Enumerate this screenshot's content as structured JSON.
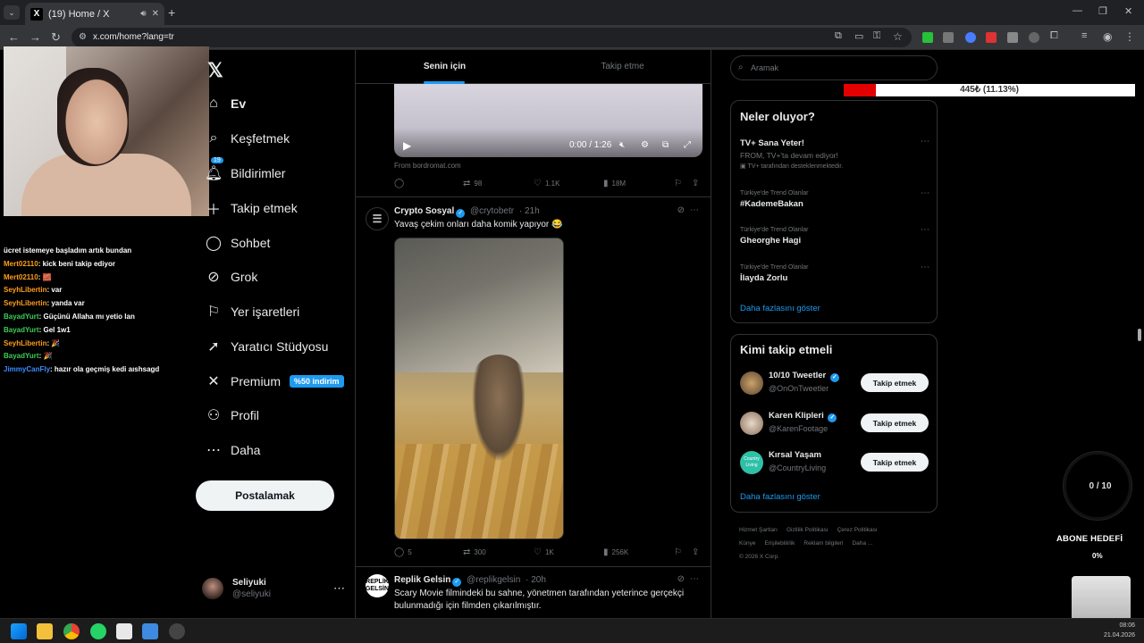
{
  "browser": {
    "tab_title": "(19) Home / X",
    "tab_favicon": "X",
    "url": "x.com/home?lang=tr"
  },
  "chat": [
    {
      "user": "",
      "msg": "ücret istemeye başladım artık bundan",
      "color": "#ffffff"
    },
    {
      "user": "Mert02110",
      "msg": ": kick beni takip ediyor",
      "color": "#ff9f1a"
    },
    {
      "user": "Mert02110",
      "msg": ": 🧱",
      "color": "#ff9f1a"
    },
    {
      "user": "SeyhLibertin",
      "msg": ": var",
      "color": "#ff9f1a"
    },
    {
      "user": "SeyhLibertin",
      "msg": ": yanda var",
      "color": "#ff9f1a"
    },
    {
      "user": "BayadYurt",
      "msg": ": Güçünü Allaha mı yetio lan",
      "color": "#3ccf5a"
    },
    {
      "user": "BayadYurt",
      "msg": ": Gel 1w1",
      "color": "#3ccf5a"
    },
    {
      "user": "SeyhLibertin",
      "msg": ": 🎉",
      "color": "#ff9f1a"
    },
    {
      "user": "BayadYurt",
      "msg": ": 🎉",
      "color": "#3ccf5a"
    },
    {
      "user": "JimmyCanFly",
      "msg": ": hazır ola geçmiş kedi aıshsagd",
      "color": "#3c8cff"
    }
  ],
  "nav": {
    "items": [
      {
        "label": "Ev",
        "icon": "home-icon",
        "glyph": "⌂"
      },
      {
        "label": "Keşfetmek",
        "icon": "search-icon",
        "glyph": "⌕"
      },
      {
        "label": "Bildirimler",
        "icon": "bell-icon",
        "glyph": "🔔︎"
      },
      {
        "label": "Takip etmek",
        "icon": "follow-icon",
        "glyph": "＋"
      },
      {
        "label": "Sohbet",
        "icon": "chat-icon",
        "glyph": "◯"
      },
      {
        "label": "Grok",
        "icon": "grok-icon",
        "glyph": "⊘"
      },
      {
        "label": "Yer işaretleri",
        "icon": "bookmark-icon",
        "glyph": "⚐"
      },
      {
        "label": "Yaratıcı Stüdyosu",
        "icon": "rocket-icon",
        "glyph": "➚"
      },
      {
        "label": "Premium",
        "icon": "x-logo-icon",
        "glyph": "✕"
      },
      {
        "label": "Profil",
        "icon": "profile-icon",
        "glyph": "⚇"
      },
      {
        "label": "Daha",
        "icon": "more-circle-icon",
        "glyph": "⋯"
      }
    ],
    "notif_count": "19",
    "premium_badge": "%50 indirim",
    "post_label": "Postalamak",
    "account_name": "Seliyuki",
    "account_handle": "@seliyuki"
  },
  "feed": {
    "tabs": [
      "Senin için",
      "Takip etme"
    ],
    "video": {
      "time": "0:00 / 1:26",
      "from": "From bordromat.com",
      "replies": "",
      "retweets": "98",
      "likes": "1.1K",
      "views": "18M"
    },
    "tweet1": {
      "name": "Crypto Sosyal",
      "handle": "@crytobetr",
      "time": "· 21h",
      "text": "Yavaş çekim onları daha komik yapıyor 😂",
      "replies": "5",
      "retweets": "300",
      "likes": "1K",
      "views": "256K"
    },
    "tweet2": {
      "name": "Replik Gelsin",
      "handle": "@replikgelsin",
      "time": "· 20h",
      "avatar_text": "REPLİK GELSİN",
      "text": "Scary Movie filmindeki bu sahne, yönetmen tarafından yeterince gerçekçi bulunmadığı için filmden çıkarılmıştır."
    }
  },
  "right": {
    "search_placeholder": "Aramak",
    "donation": {
      "text": "445₺ (11.13%)",
      "fraction": 0.1113
    },
    "trends_title": "Neler oluyor?",
    "trends": [
      {
        "context": "",
        "name": "TV+ Sana Yeter!",
        "sub": "FROM, TV+'ta devam ediyor!",
        "ad": "TV+ tarafından desteklenmektedir."
      },
      {
        "context": "Türkiye'de Trend Olanlar",
        "name": "#KademeBakan"
      },
      {
        "context": "Türkiye'de Trend Olanlar",
        "name": "Gheorghe Hagi"
      },
      {
        "context": "Türkiye'de Trend Olanlar",
        "name": "İlayda Zorlu"
      }
    ],
    "show_more": "Daha fazlasını göster",
    "who_title": "Kimi takip etmeli",
    "who": [
      {
        "name": "10/10 Tweetler",
        "handle": "@OnOnTweetler",
        "follow": "Takip etmek",
        "color": "#7a6040"
      },
      {
        "name": "Karen Klipleri",
        "handle": "@KarenFootage",
        "follow": "Takip etmek",
        "color": "#c8b6a0"
      },
      {
        "name": "Kırsal Yaşam",
        "handle": "@CountryLiving",
        "follow": "Takip etmek",
        "color": "#2fc0a8",
        "avatar_text": "Country Living"
      }
    ],
    "show_more_2": "Daha fazlasını göster",
    "footer": [
      "Hizmet Şartları",
      "Gizlilik Politikası",
      "Çerez Politikası",
      "Künye",
      "Erişilebilirlik",
      "Reklam bilgileri",
      "Daha ...",
      "© 2026 X Corp."
    ]
  },
  "overlay": {
    "goal": "0 / 10",
    "sub_goal": "ABONE HEDEFİ",
    "sub_pct": "0%"
  },
  "taskbar": {
    "time": "08:06",
    "date": "21.04.2026"
  }
}
